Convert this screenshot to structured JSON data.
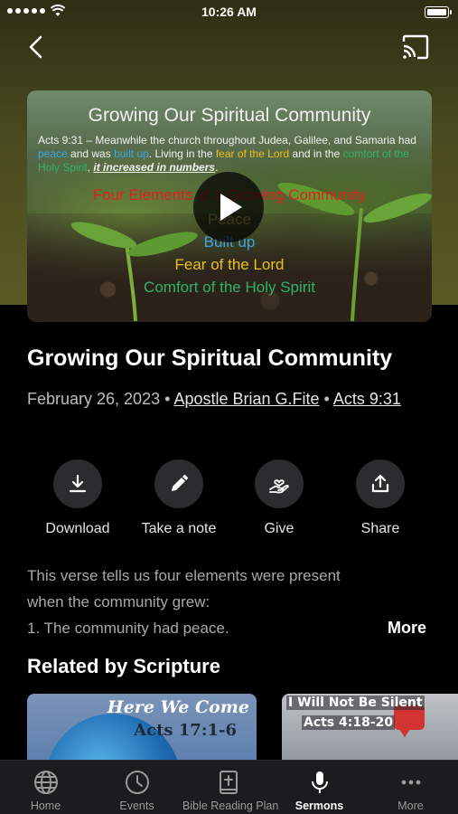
{
  "status_bar": {
    "time": "10:26 AM"
  },
  "video": {
    "slide_title": "Growing Our Spiritual Community",
    "verse_intro": "Acts 9:31 – Meanwhile the church throughout Judea, Galilee, and Samaria had ",
    "verse_peace": "peace",
    "verse_mid1": " and was ",
    "verse_built": "built up",
    "verse_mid2": ". Living in the ",
    "verse_fear": "fear of the Lord",
    "verse_mid3": " and in the ",
    "verse_comfort": "comfort of the Holy Spirit",
    "verse_mid4": ", ",
    "verse_increase": "it increased in numbers",
    "verse_end": ".",
    "elements_heading": "Four Elements of a Growing Community",
    "elements": [
      "Peace",
      "Built up",
      "Fear of the Lord",
      "Comfort of the Holy Spirit"
    ]
  },
  "sermon": {
    "title": "Growing Our Spiritual Community",
    "date": "February 26, 2023",
    "separator": "•",
    "speaker": "Apostle Brian G.Fite",
    "scripture": "Acts 9:31"
  },
  "actions": [
    {
      "label": "Download",
      "icon": "download-icon"
    },
    {
      "label": "Take a note",
      "icon": "pencil-icon"
    },
    {
      "label": "Give",
      "icon": "give-heart-hand-icon"
    },
    {
      "label": "Share",
      "icon": "share-icon"
    }
  ],
  "description": {
    "line1": "This verse tells us four elements were present",
    "line2": "when the community grew:",
    "line3": "1.  The community had peace.",
    "more_label": "More"
  },
  "related": {
    "heading": "Related by Scripture",
    "cards": [
      {
        "line1": "Here We Come",
        "line2": "Acts 17:1-6"
      },
      {
        "line1": "I Will Not Be Silent",
        "line2": "Acts 4:18-20"
      }
    ]
  },
  "tabs": [
    {
      "label": "Home",
      "icon": "globe-icon",
      "active": false
    },
    {
      "label": "Events",
      "icon": "clock-icon",
      "active": false
    },
    {
      "label": "Bible Reading Plan",
      "icon": "bible-icon",
      "active": false
    },
    {
      "label": "Sermons",
      "icon": "microphone-icon",
      "active": true
    },
    {
      "label": "More",
      "icon": "ellipsis-icon",
      "active": false
    }
  ],
  "colors": {
    "accent_blue": "#39a8e0",
    "accent_yellow": "#e9c01c",
    "accent_green": "#2fb36a",
    "accent_red": "#e0201c"
  }
}
